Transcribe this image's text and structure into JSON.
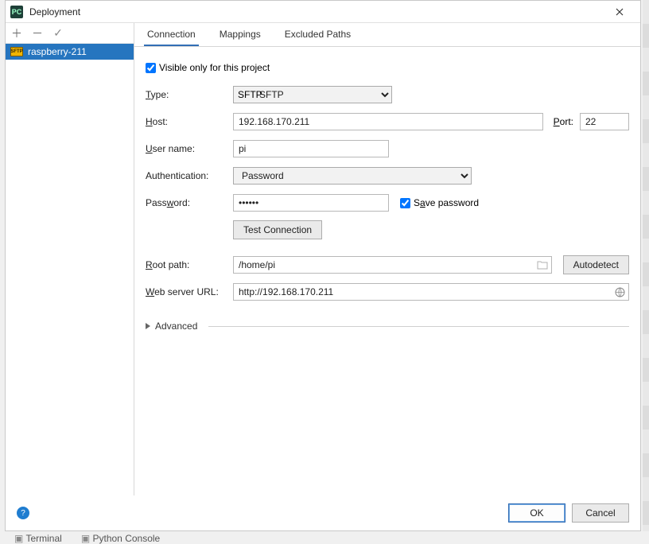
{
  "window": {
    "title": "Deployment"
  },
  "sidebar": {
    "items": [
      {
        "label": "raspberry-211"
      }
    ]
  },
  "tabs": {
    "connection": "Connection",
    "mappings": "Mappings",
    "excluded": "Excluded Paths"
  },
  "form": {
    "visible_only_label": "Visible only for this project",
    "visible_only_checked": true,
    "type_label": "Type:",
    "type_value": "SFTP",
    "host_label": "Host:",
    "host_value": "192.168.170.211",
    "port_label": "Port:",
    "port_value": "22",
    "user_label": "User name:",
    "user_value": "pi",
    "auth_label": "Authentication:",
    "auth_value": "Password",
    "password_label": "Password:",
    "password_value": "••••••",
    "save_password_label": "Save password",
    "save_password_checked": true,
    "test_connection_label": "Test Connection",
    "root_label": "Root path:",
    "root_value": "/home/pi",
    "autodetect_label": "Autodetect",
    "weburl_label": "Web server URL:",
    "weburl_value": "http://192.168.170.211",
    "advanced_label": "Advanced"
  },
  "buttons": {
    "ok": "OK",
    "cancel": "Cancel"
  },
  "bg": {
    "terminal": "Terminal",
    "pyconsole": "Python Console"
  },
  "icons": {
    "sftp_badge": "SFTP"
  }
}
